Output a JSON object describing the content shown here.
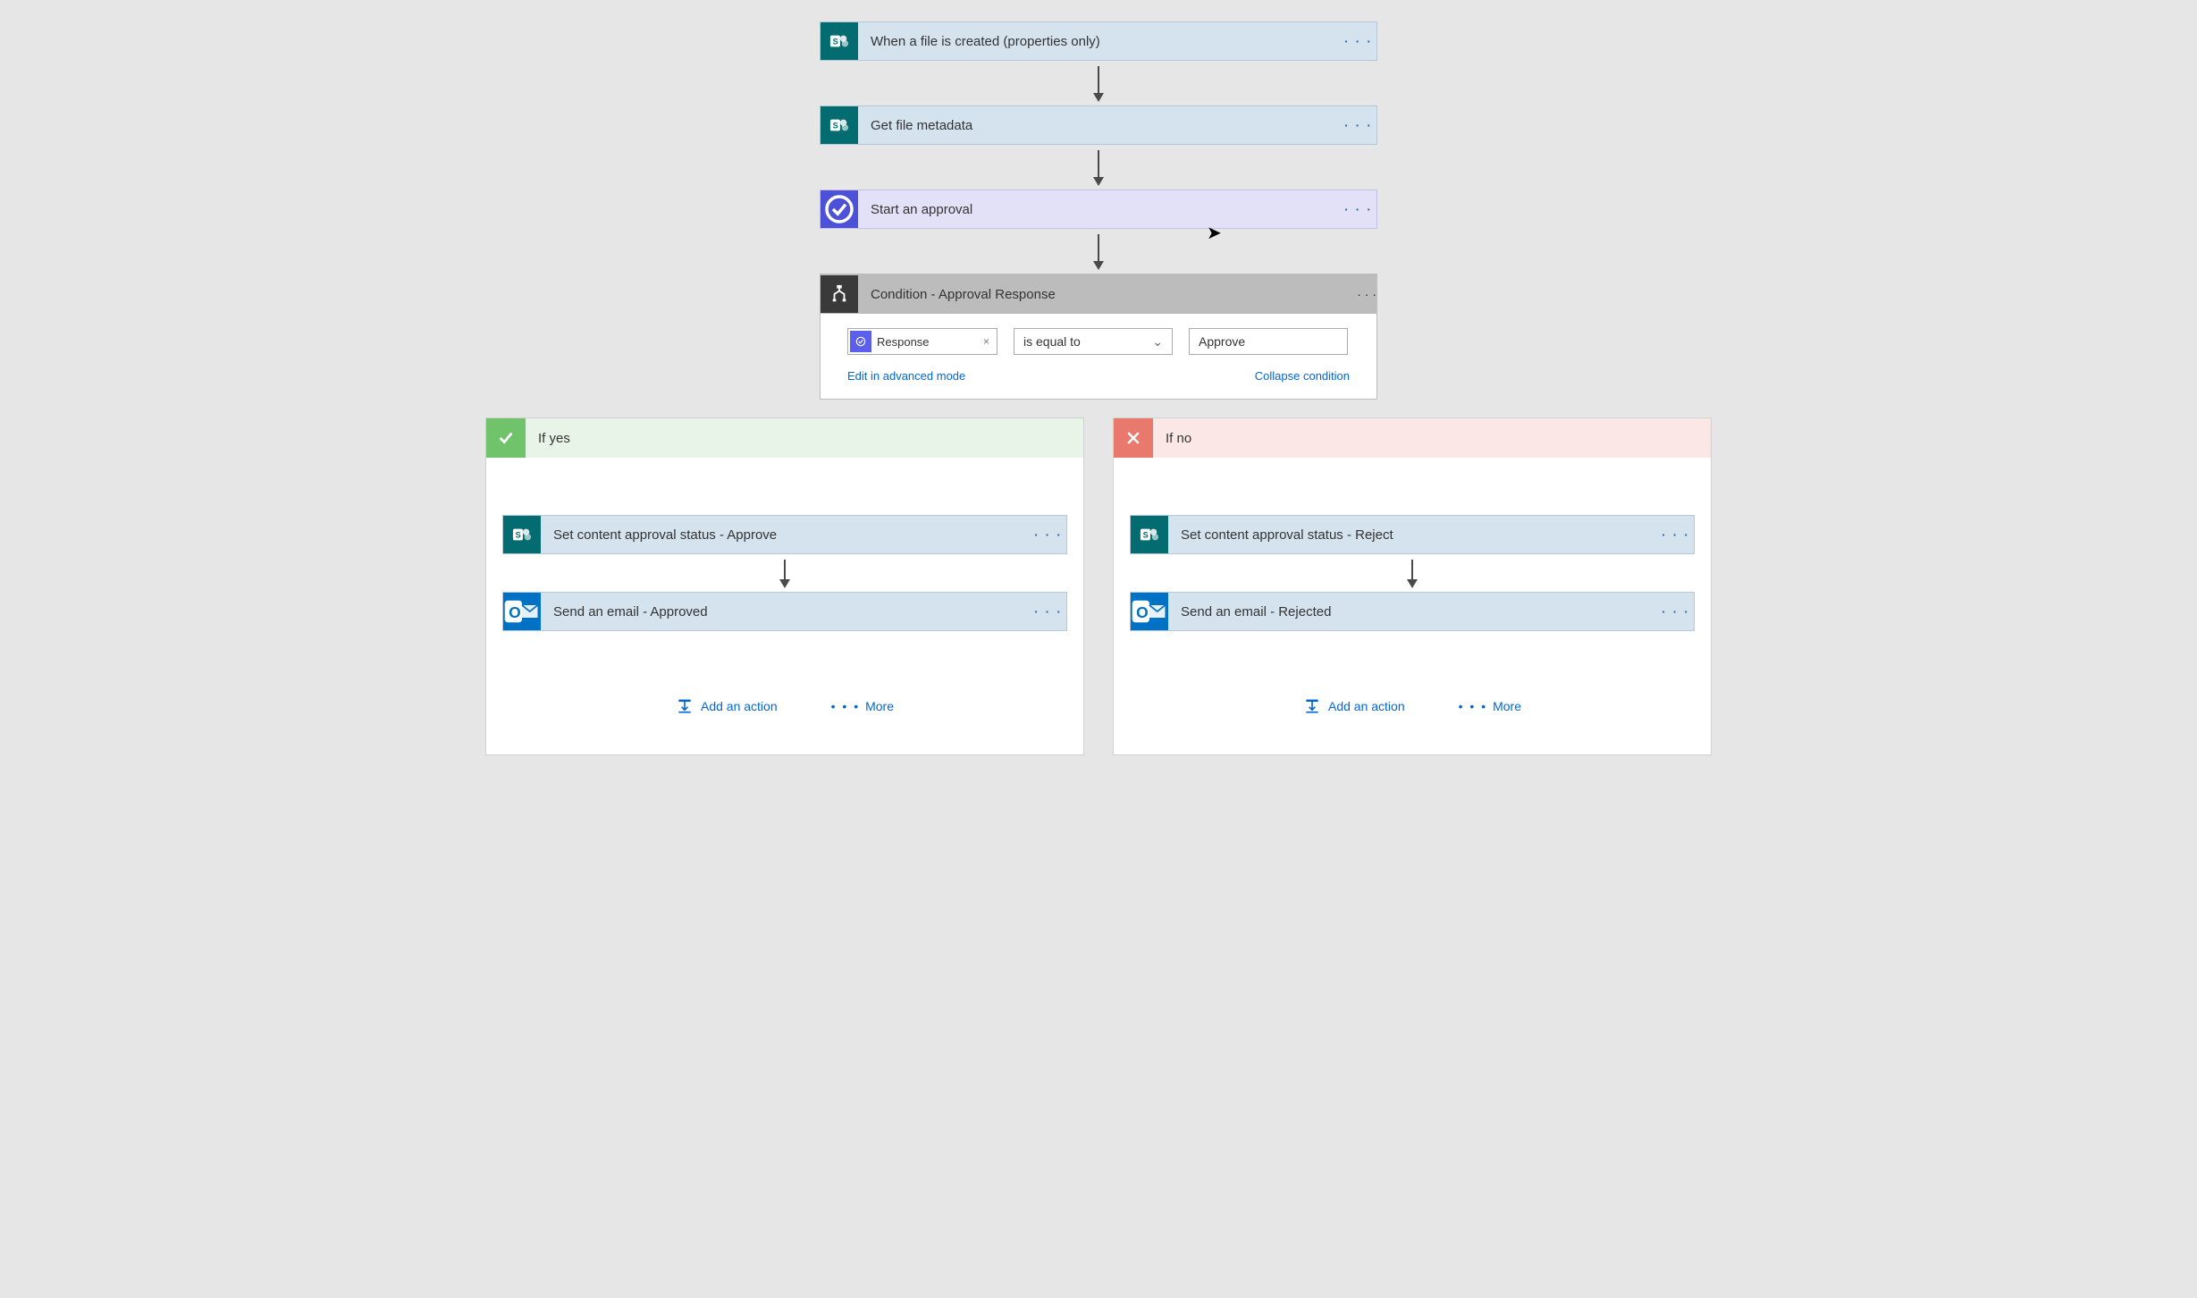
{
  "steps": {
    "trigger": "When a file is created (properties only)",
    "metadata": "Get file metadata",
    "approval": "Start an approval"
  },
  "condition": {
    "title": "Condition - Approval Response",
    "token": "Response",
    "operator": "is equal to",
    "value": "Approve",
    "edit_link": "Edit in advanced mode",
    "collapse_link": "Collapse condition"
  },
  "branches": {
    "yes": {
      "title": "If yes",
      "step1": "Set content approval status - Approve",
      "step2": "Send an email - Approved"
    },
    "no": {
      "title": "If no",
      "step1": "Set content approval status - Reject",
      "step2": "Send an email - Rejected"
    }
  },
  "footer": {
    "add_action": "Add an action",
    "more": "More"
  },
  "glyphs": {
    "ellipsis": "· · ·",
    "x": "×",
    "chev": "⌄",
    "check": "✓",
    "dots3": "• • •"
  }
}
